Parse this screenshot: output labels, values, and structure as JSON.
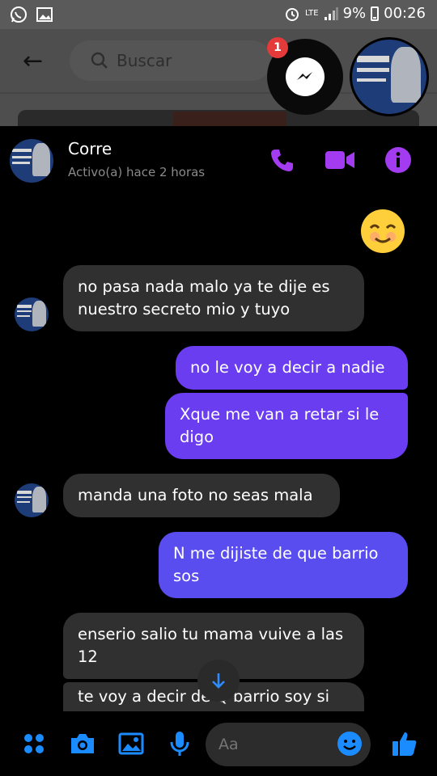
{
  "status_bar": {
    "network": "LTE",
    "battery": "9%",
    "time": "00:26"
  },
  "background_app": {
    "search_placeholder": "Buscar"
  },
  "chat_heads": {
    "unread_badge": "1"
  },
  "header": {
    "name": "Corre",
    "status": "Activo(a) hace 2 horas"
  },
  "messages": [
    {
      "side": "in",
      "text": "no pasa nada malo ya te dije es nuestro secreto mio y tuyo"
    },
    {
      "side": "out",
      "text": "no le voy a decir a nadie"
    },
    {
      "side": "out",
      "text": "Xque me van a retar si le digo"
    },
    {
      "side": "in",
      "text": "manda una foto no seas mala"
    },
    {
      "side": "out",
      "text": "N me dijiste de que barrio sos"
    },
    {
      "side": "in",
      "text": "enserio salio tu mama vuive a las 12"
    },
    {
      "side": "in",
      "text": "te voy a decir de Q barrio soy si"
    }
  ],
  "composer": {
    "placeholder": "Aa"
  },
  "colors": {
    "accent": "#a33cf0",
    "composer_icons": "#1a8cff",
    "outgoing_bubble": "#6a3df0",
    "incoming_bubble": "#303030"
  }
}
